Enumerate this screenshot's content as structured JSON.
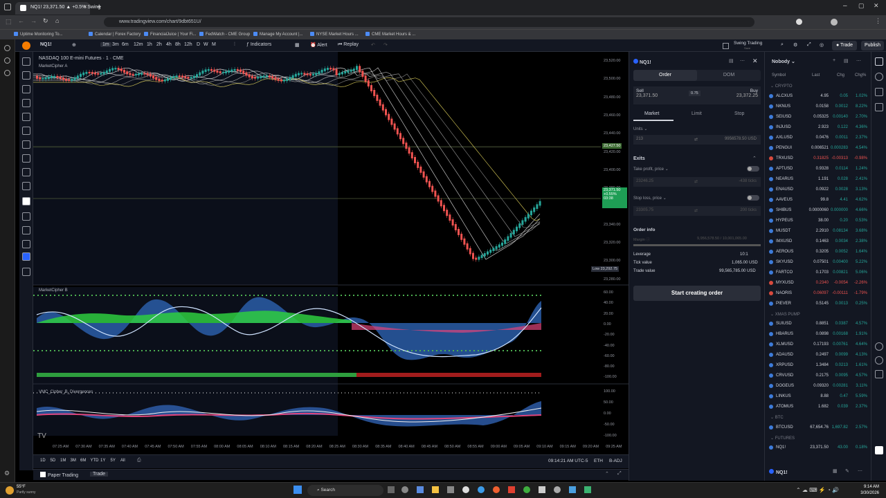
{
  "browser": {
    "tab_title": "NQ1! 23,371.50 ▲ +0.5% Swing",
    "url": "www.tradingview.com/chart/9dbt651U/",
    "bookmarks": [
      "Uptime Monitoring To...",
      "Calendar | Forex Factory",
      "FinancialJuice | Your Fi...",
      "FedWatch - CME Group",
      "Manage My Account |...",
      "NYSE Market Hours ...",
      "CME Market Hours & ..."
    ]
  },
  "toolbar": {
    "symbol": "NQ1!",
    "intervals": [
      "1m",
      "3m",
      "6m",
      "12m",
      "1h",
      "2h",
      "4h",
      "8h",
      "12h",
      "D",
      "W",
      "M"
    ],
    "indicators_label": "Indicators",
    "alert_label": "Alert",
    "replay_label": "Replay",
    "layout_name": "Swing Trading",
    "layout_sub": "Save",
    "trade_label": "Trade",
    "publish_label": "Publish"
  },
  "chart": {
    "title": "NASDAQ 100 E-mini Futures · 1 · CME",
    "indicator1": "MarketCipher A",
    "indicator2": "MarketCipher B",
    "indicator3": "VMC_Cipher_B_Divergences",
    "price_axis": [
      "23,520.00",
      "23,500.00",
      "23,480.00",
      "23,460.00",
      "23,440.00",
      "23,420.00",
      "23,400.00",
      "23,380.00",
      "23,360.00",
      "23,340.00",
      "23,320.00",
      "23,300.00",
      "23,280.00"
    ],
    "price_tag_1": "23,427.50",
    "price_tag_2": "23,371.50",
    "price_tag_2b": "+0.55%",
    "price_tag_2c": "03:38",
    "low_label": "Low",
    "low_value": "23,292.75",
    "osc_axis": [
      "60.00",
      "40.00",
      "20.00",
      "0.00",
      "-20.00",
      "-40.00",
      "-60.00",
      "-80.00",
      "-100.00"
    ],
    "osc2_axis": [
      "100.00",
      "50.00",
      "0.00",
      "-50.00",
      "-100.00"
    ],
    "time_axis": [
      "07:25 AM",
      "07:30 AM",
      "07:35 AM",
      "07:40 AM",
      "07:45 AM",
      "07:50 AM",
      "07:55 AM",
      "08:00 AM",
      "08:05 AM",
      "08:10 AM",
      "08:15 AM",
      "08:20 AM",
      "08:25 AM",
      "08:30 AM",
      "08:35 AM",
      "08:40 AM",
      "08:45 AM",
      "08:50 AM",
      "08:55 AM",
      "09:00 AM",
      "09:05 AM",
      "09:10 AM",
      "09:15 AM",
      "09:20 AM",
      "09:25 AM"
    ],
    "ranges": [
      "1D",
      "5D",
      "1M",
      "3M",
      "6M",
      "YTD",
      "1Y",
      "5Y",
      "All"
    ],
    "clock": "09:14:21 AM UTC-5",
    "session": "ETH",
    "adj": "B-ADJ",
    "tabs": [
      "Paper Trading",
      "Trade"
    ]
  },
  "order": {
    "symbol": "NQ1!",
    "tab_order": "Order",
    "tab_dom": "DOM",
    "sell_label": "Sell",
    "sell_price": "23,371.50",
    "spread": "0.75",
    "buy_label": "Buy",
    "buy_price": "23,372.25",
    "types": [
      "Market",
      "Limit",
      "Stop"
    ],
    "units_label": "Units",
    "units_value": "213",
    "units_usd": "9956578.50 USD",
    "exits_label": "Exits",
    "tp_label": "Take profit, price",
    "tp_value": "23246.25",
    "tp_ticks": "-438 ticks",
    "sl_label": "Stop loss, price",
    "sl_value": "23305.75",
    "sl_ticks": "200 ticks",
    "info_label": "Order info",
    "margin_label": "Margin",
    "margin_value": "9,956,578.50 / 10,001,065.00",
    "leverage_label": "Leverage",
    "leverage_value": "10:1",
    "tick_label": "Tick value",
    "tick_value": "1,065.00 USD",
    "trade_label": "Trade value",
    "trade_value": "99,565,785.00 USD",
    "submit": "Start creating order"
  },
  "watchlist": {
    "title": "Nobody",
    "cols": [
      "Symbol",
      "Last",
      "Chg",
      "Chg%"
    ],
    "sections": [
      "CRYPTO",
      "XMAS PUMP",
      "BTC",
      "FUTURES"
    ],
    "crypto": [
      {
        "s": "ALCXUS",
        "l": "4.95",
        "c": "0.05",
        "p": "1.02%",
        "up": true
      },
      {
        "s": "NKNUS",
        "l": "0.0158",
        "c": "0.0012",
        "p": "8.22%",
        "up": true
      },
      {
        "s": "SEIUSD",
        "l": "0.05325",
        "c": "0.00140",
        "p": "2.70%",
        "up": true
      },
      {
        "s": "INJUSD",
        "l": "2.923",
        "c": "0.122",
        "p": "4.36%",
        "up": true
      },
      {
        "s": "AXLUSD",
        "l": "0.0476",
        "c": "0.0011",
        "p": "2.37%",
        "up": true
      },
      {
        "s": "PENGUI",
        "l": "0.006521",
        "c": "0.000283",
        "p": "4.54%",
        "up": true
      },
      {
        "s": "TRXUSD",
        "l": "0.31825",
        "c": "-0.00313",
        "p": "-0.98%",
        "up": false
      },
      {
        "s": "APTUSD",
        "l": "0.9328",
        "c": "0.0114",
        "p": "1.24%",
        "up": true
      },
      {
        "s": "NEARUS",
        "l": "1.191",
        "c": "0.028",
        "p": "2.41%",
        "up": true
      },
      {
        "s": "ENAUSD",
        "l": "0.0922",
        "c": "0.0028",
        "p": "3.13%",
        "up": true
      },
      {
        "s": "AAVEUS",
        "l": "99.8",
        "c": "4.41",
        "p": "4.62%",
        "up": true
      },
      {
        "s": "SHIBUS",
        "l": "0.0000060",
        "c": "0.000000",
        "p": "4.66%",
        "up": true
      },
      {
        "s": "HYPEUS",
        "l": "38.00",
        "c": "0.20",
        "p": "0.53%",
        "up": true
      },
      {
        "s": "MUSDT",
        "l": "2.2910",
        "c": "0.08134",
        "p": "3.68%",
        "up": true
      },
      {
        "s": "IMXUSD",
        "l": "0.1463",
        "c": "0.0034",
        "p": "2.38%",
        "up": true
      },
      {
        "s": "AEROUS",
        "l": "0.3205",
        "c": "0.0052",
        "p": "1.64%",
        "up": true
      },
      {
        "s": "SKYUSD",
        "l": "0.07501",
        "c": "0.00400",
        "p": "5.22%",
        "up": true
      },
      {
        "s": "FARTCO",
        "l": "0.1703",
        "c": "0.00821",
        "p": "5.06%",
        "up": true
      },
      {
        "s": "MYXUSD",
        "l": "0.2340",
        "c": "-0.0054",
        "p": "-2.26%",
        "up": false
      },
      {
        "s": "NAORIS",
        "l": "0.06097",
        "c": "-0.00111",
        "p": "-1.79%",
        "up": false
      },
      {
        "s": "PIEVER",
        "l": "0.5145",
        "c": "0.0013",
        "p": "0.25%",
        "up": true
      }
    ],
    "xmas": [
      {
        "s": "SUIUSD",
        "l": "0.8851",
        "c": "0.0387",
        "p": "4.57%",
        "up": true
      },
      {
        "s": "HBARUS",
        "l": "0.0898",
        "c": "0.00168",
        "p": "1.91%",
        "up": true
      },
      {
        "s": "XLMUSD",
        "l": "0.17193",
        "c": "0.00761",
        "p": "4.64%",
        "up": true
      },
      {
        "s": "ADAUSD",
        "l": "0.2497",
        "c": "0.0099",
        "p": "4.13%",
        "up": true
      },
      {
        "s": "XRPUSD",
        "l": "1.3484",
        "c": "0.0213",
        "p": "1.61%",
        "up": true
      },
      {
        "s": "CRVUSD",
        "l": "0.2175",
        "c": "0.0095",
        "p": "4.57%",
        "up": true
      },
      {
        "s": "DOGEUS",
        "l": "0.09320",
        "c": "0.00281",
        "p": "3.11%",
        "up": true
      },
      {
        "s": "LINKUS",
        "l": "8.88",
        "c": "0.47",
        "p": "5.59%",
        "up": true
      },
      {
        "s": "ATOMUS",
        "l": "1.682",
        "c": "0.039",
        "p": "2.37%",
        "up": true
      }
    ],
    "btc": [
      {
        "s": "BTCUSD",
        "l": "67,654.76",
        "c": "1,697.82",
        "p": "2.57%",
        "up": true
      }
    ],
    "futures": [
      {
        "s": "NQ1!",
        "l": "23,371.50",
        "c": "43.00",
        "p": "0.18%",
        "up": true
      }
    ],
    "footer_symbol": "NQ1!"
  },
  "taskbar": {
    "weather_temp": "55°F",
    "weather_desc": "Partly sunny",
    "search": "Search",
    "time": "9:14 AM",
    "date": "3/30/2026"
  },
  "colors": {
    "up": "#26a69a",
    "down": "#ef5350",
    "accent": "#2962ff",
    "bg": "#131722"
  }
}
